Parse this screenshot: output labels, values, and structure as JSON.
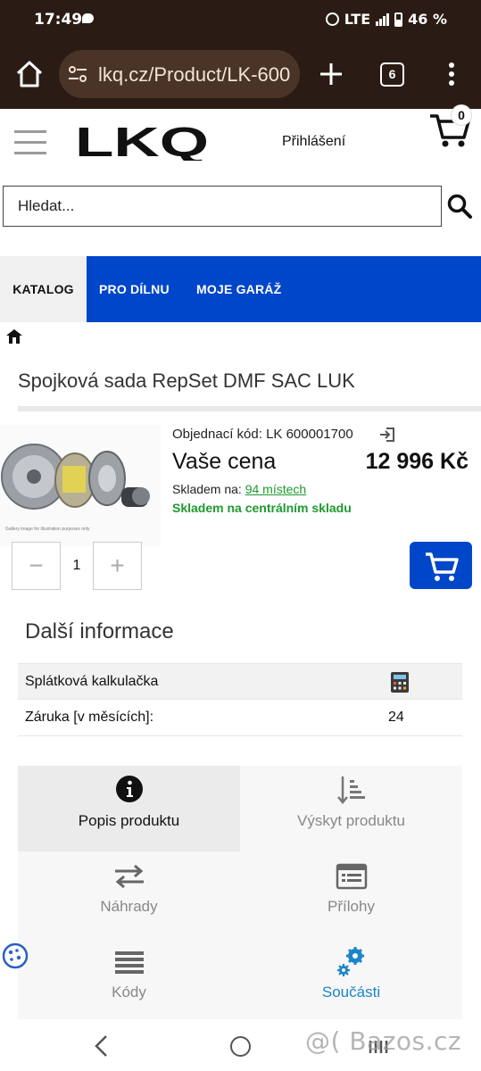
{
  "status": {
    "time": "17:49",
    "network": "LTE",
    "battery": "46 %"
  },
  "browser": {
    "url": "lkq.cz/Product/LK-600",
    "tab_count": "6"
  },
  "header": {
    "logo": "LKQ",
    "login": "Přihlášení",
    "cart_count": "0"
  },
  "search": {
    "placeholder": "Hledat..."
  },
  "nav": {
    "tabs": [
      {
        "label": "KATALOG"
      },
      {
        "label": "PRO DÍLNU"
      },
      {
        "label": "MOJE GARÁŽ"
      }
    ]
  },
  "product": {
    "title": "Spojková sada RepSet DMF SAC LUK",
    "order_code": "Objednací kód: LK 600001700",
    "price_label": "Vaše cena",
    "price": "12 996 Kč",
    "stock_prefix": "Skladem na: ",
    "stock_link": "94 místech",
    "stock_central": "Skladem na centrálním skladu",
    "image_caption": "Gallery image for illustration purposes only",
    "quantity": "1",
    "qty_minus": "−",
    "qty_plus": "+"
  },
  "info": {
    "title": "Další informace",
    "rows": [
      {
        "key": "Splátková kalkulačka",
        "value": ""
      },
      {
        "key": "Záruka [v měsících]:",
        "value": "24"
      }
    ]
  },
  "tiles": [
    {
      "label": "Popis produktu",
      "icon": "info-icon"
    },
    {
      "label": "Výskyt produktu",
      "icon": "sort-icon"
    },
    {
      "label": "Náhrady",
      "icon": "swap-icon"
    },
    {
      "label": "Přílohy",
      "icon": "attachment-icon"
    },
    {
      "label": "Kódy",
      "icon": "list-icon"
    },
    {
      "label": "Součásti",
      "icon": "gears-icon"
    }
  ],
  "watermark": "@( Bazos.cz",
  "colors": {
    "brand_blue": "#0046c9",
    "stock_green": "#1d9a2f",
    "browser_bar": "#2a1c14"
  }
}
